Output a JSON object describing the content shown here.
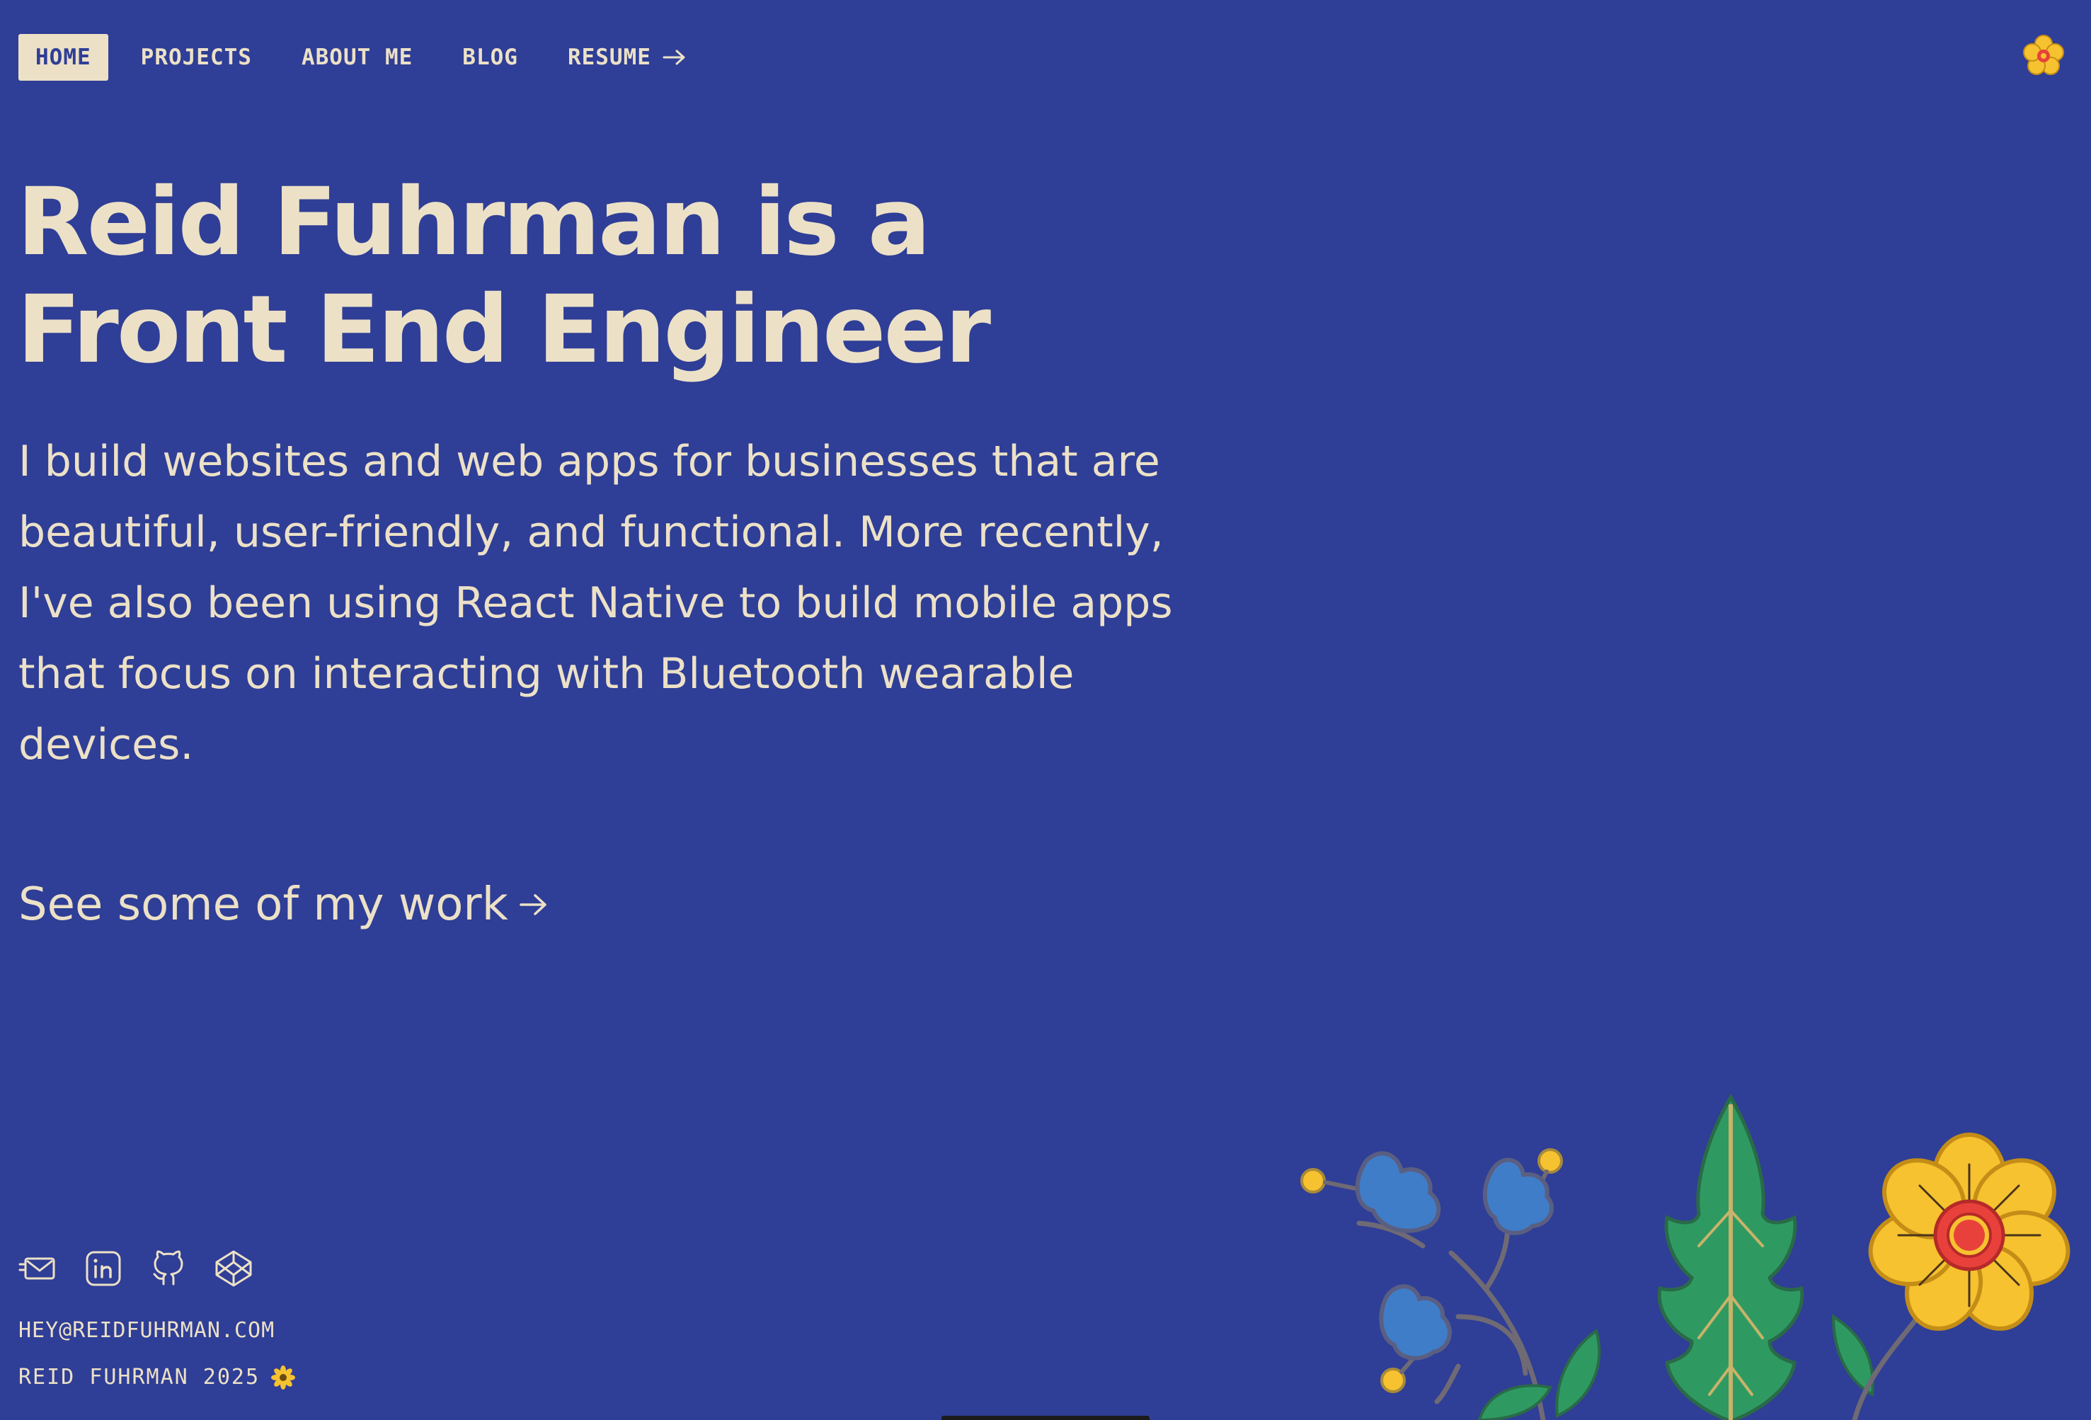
{
  "colors": {
    "background": "#2f3e96",
    "foreground": "#ece1c7",
    "flower_yellow": "#f6c22f",
    "flower_center": "#e8413b",
    "flower_blue": "#3f7dc9",
    "leaf_green": "#2e9a62"
  },
  "nav": {
    "items": [
      {
        "label": "HOME",
        "active": true
      },
      {
        "label": "PROJECTS",
        "active": false
      },
      {
        "label": "ABOUT ME",
        "active": false
      },
      {
        "label": "BLOG",
        "active": false
      },
      {
        "label": "RESUME",
        "active": false,
        "icon": "arrow-right-icon"
      }
    ],
    "corner_icon": "flower-icon"
  },
  "hero": {
    "headline_line1": "Reid Fuhrman is a",
    "headline_line2": "Front End Engineer",
    "intro": "I build websites and web apps for businesses that are beautiful, user-friendly, and functional. More recently, I've also been using React Native to build mobile apps that focus on interacting with Bluetooth wearable devices.",
    "cta_label": "See some of my work",
    "cta_icon": "arrow-right-icon"
  },
  "footer": {
    "social_icons": [
      "mail-icon",
      "linkedin-icon",
      "github-icon",
      "codepen-icon"
    ],
    "email": "HEY@REIDFUHRMAN.COM",
    "copyright": "REID FUHRMAN 2025",
    "copyright_icon": "flower-icon"
  },
  "illustration": {
    "description_icon": "flowers-illustration"
  }
}
